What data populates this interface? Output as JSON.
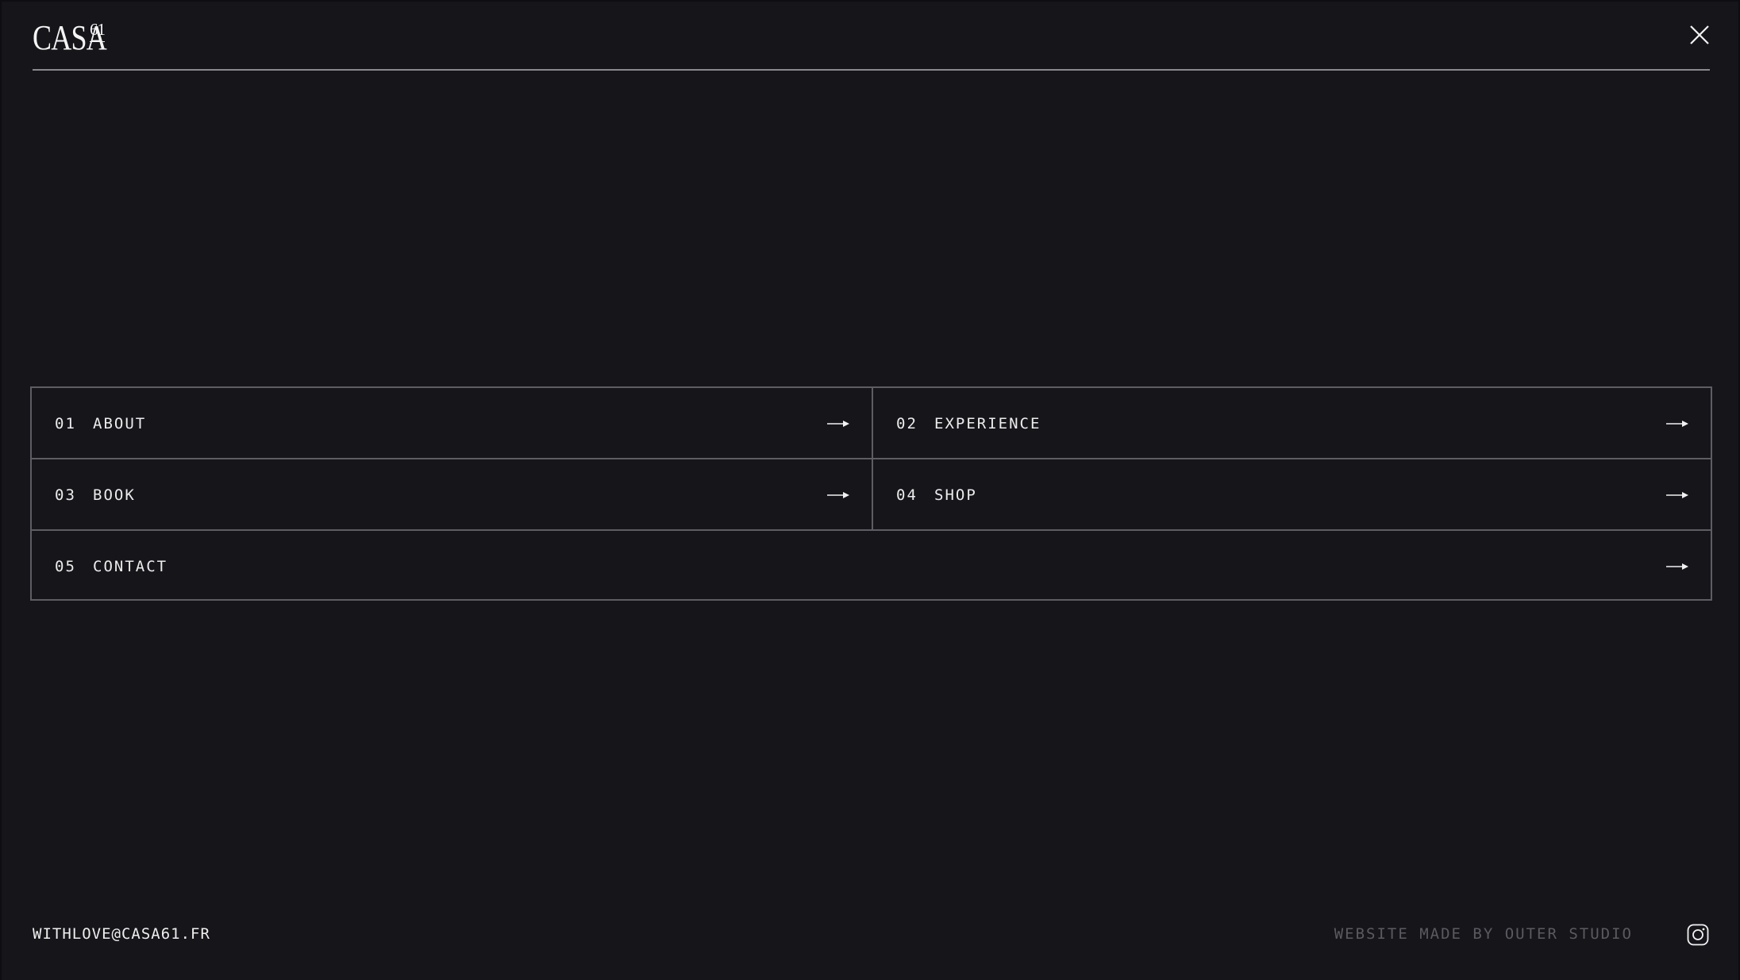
{
  "header": {
    "logo_text": "CASA",
    "logo_superscript": "61",
    "close_icon": "close-icon"
  },
  "menu": {
    "items": [
      {
        "number": "01",
        "label": "ABOUT",
        "icon": "arrow-right-icon"
      },
      {
        "number": "02",
        "label": "EXPERIENCE",
        "icon": "arrow-right-icon"
      },
      {
        "number": "03",
        "label": "BOOK",
        "icon": "arrow-right-icon"
      },
      {
        "number": "04",
        "label": "SHOP",
        "icon": "arrow-right-icon"
      },
      {
        "number": "05",
        "label": "CONTACT",
        "icon": "arrow-right-icon"
      }
    ]
  },
  "footer": {
    "email": "WITHLOVE@CASA61.FR",
    "credit": "WEBSITE MADE BY OUTER STUDIO",
    "social_icon": "instagram-icon"
  },
  "colors": {
    "background": "#16151a",
    "text": "#f2f2f2",
    "border": "#5e5d63",
    "muted": "#5b5a60"
  }
}
